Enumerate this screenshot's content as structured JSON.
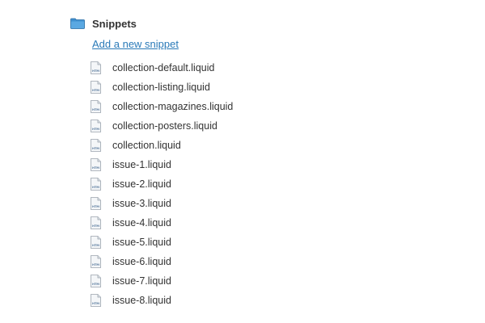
{
  "folder": {
    "title": "Snippets",
    "icon": "folder-icon",
    "icon_color": "#3f8fcf"
  },
  "add_link": {
    "label": "Add a new snippet",
    "color": "#2a7ab8"
  },
  "file_icon": {
    "name": "htm-file-icon",
    "label": "HTM"
  },
  "files": [
    "collection-default.liquid",
    "collection-listing.liquid",
    "collection-magazines.liquid",
    "collection-posters.liquid",
    "collection.liquid",
    "issue-1.liquid",
    "issue-2.liquid",
    "issue-3.liquid",
    "issue-4.liquid",
    "issue-5.liquid",
    "issue-6.liquid",
    "issue-7.liquid",
    "issue-8.liquid"
  ]
}
